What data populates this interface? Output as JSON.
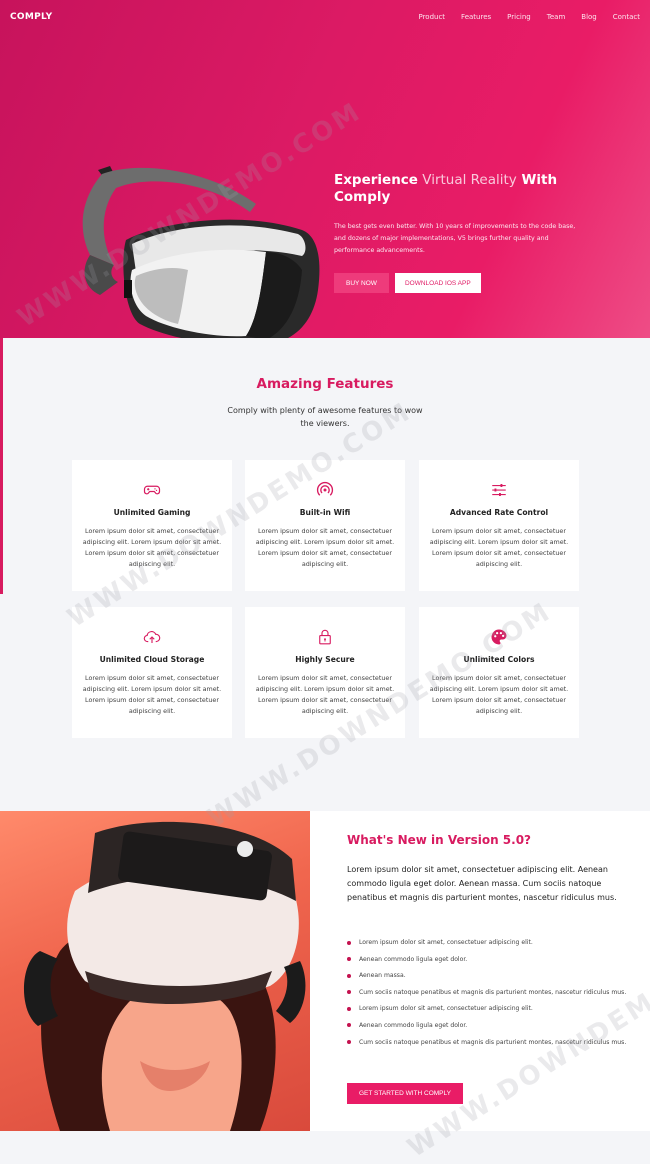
{
  "nav": {
    "logo": "COMPLY",
    "items": [
      "Product",
      "Features",
      "Pricing",
      "Team",
      "Blog",
      "Contact"
    ]
  },
  "hero": {
    "title_strong_1": "Experience",
    "title_light": " Virtual Reality",
    "title_strong_2": " With Comply",
    "description": "The best gets even better. With 10 years of improvements to the code base, and dozens of major implementations, V5 brings further quality and performance advancements.",
    "buy_label": "BUY NOW",
    "download_label": "DOWNLOAD IOS APP"
  },
  "features": {
    "title": "Amazing Features",
    "subtitle": "Comply with plenty of awesome features to wow the viewers.",
    "cards": [
      {
        "icon": "gamepad-icon",
        "title": "Unlimited Gaming",
        "text": "Lorem ipsum dolor sit amet, consectetuer adipiscing elit. Lorem ipsum dolor sit amet. Lorem ipsum dolor sit amet, consectetuer adipiscing elit."
      },
      {
        "icon": "wifi-icon",
        "title": "Built-in Wifi",
        "text": "Lorem ipsum dolor sit amet, consectetuer adipiscing elit. Lorem ipsum dolor sit amet. Lorem ipsum dolor sit amet, consectetuer adipiscing elit."
      },
      {
        "icon": "sliders-icon",
        "title": "Advanced Rate Control",
        "text": "Lorem ipsum dolor sit amet, consectetuer adipiscing elit. Lorem ipsum dolor sit amet. Lorem ipsum dolor sit amet, consectetuer adipiscing elit."
      },
      {
        "icon": "cloud-upload-icon",
        "title": "Unlimited Cloud Storage",
        "text": "Lorem ipsum dolor sit amet, consectetuer adipiscing elit. Lorem ipsum dolor sit amet. Lorem ipsum dolor sit amet, consectetuer adipiscing elit."
      },
      {
        "icon": "lock-icon",
        "title": "Highly Secure",
        "text": "Lorem ipsum dolor sit amet, consectetuer adipiscing elit. Lorem ipsum dolor sit amet. Lorem ipsum dolor sit amet, consectetuer adipiscing elit."
      },
      {
        "icon": "palette-icon",
        "title": "Unlimited Colors",
        "text": "Lorem ipsum dolor sit amet, consectetuer adipiscing elit. Lorem ipsum dolor sit amet. Lorem ipsum dolor sit amet, consectetuer adipiscing elit."
      }
    ]
  },
  "whats_new": {
    "title": "What's New in Version 5.0?",
    "lead": "Lorem ipsum dolor sit amet, consectetuer adipiscing elit. Aenean commodo ligula eget dolor. Aenean massa. Cum sociis natoque penatibus et magnis dis parturient montes, nascetur ridiculus mus.",
    "items": [
      "Lorem ipsum dolor sit amet, consectetuer adipiscing elit.",
      "Aenean commodo ligula eget dolor.",
      "Aenean massa.",
      "Cum sociis natoque penatibus et magnis dis parturient montes, nascetur ridiculus mus.",
      "Lorem ipsum dolor sit amet, consectetuer adipiscing elit.",
      "Aenean commodo ligula eget dolor.",
      "Cum sociis natoque penatibus et magnis dis parturient montes, nascetur ridiculus mus."
    ],
    "cta_label": "GET STARTED WITH COMPLY"
  },
  "watermark": "WWW.DOWNDEMO.COM",
  "colors": {
    "accent": "#d81b60",
    "hero_start": "#c7135c",
    "hero_end": "#ee4d86",
    "button_pink": "#ee3b7b"
  }
}
